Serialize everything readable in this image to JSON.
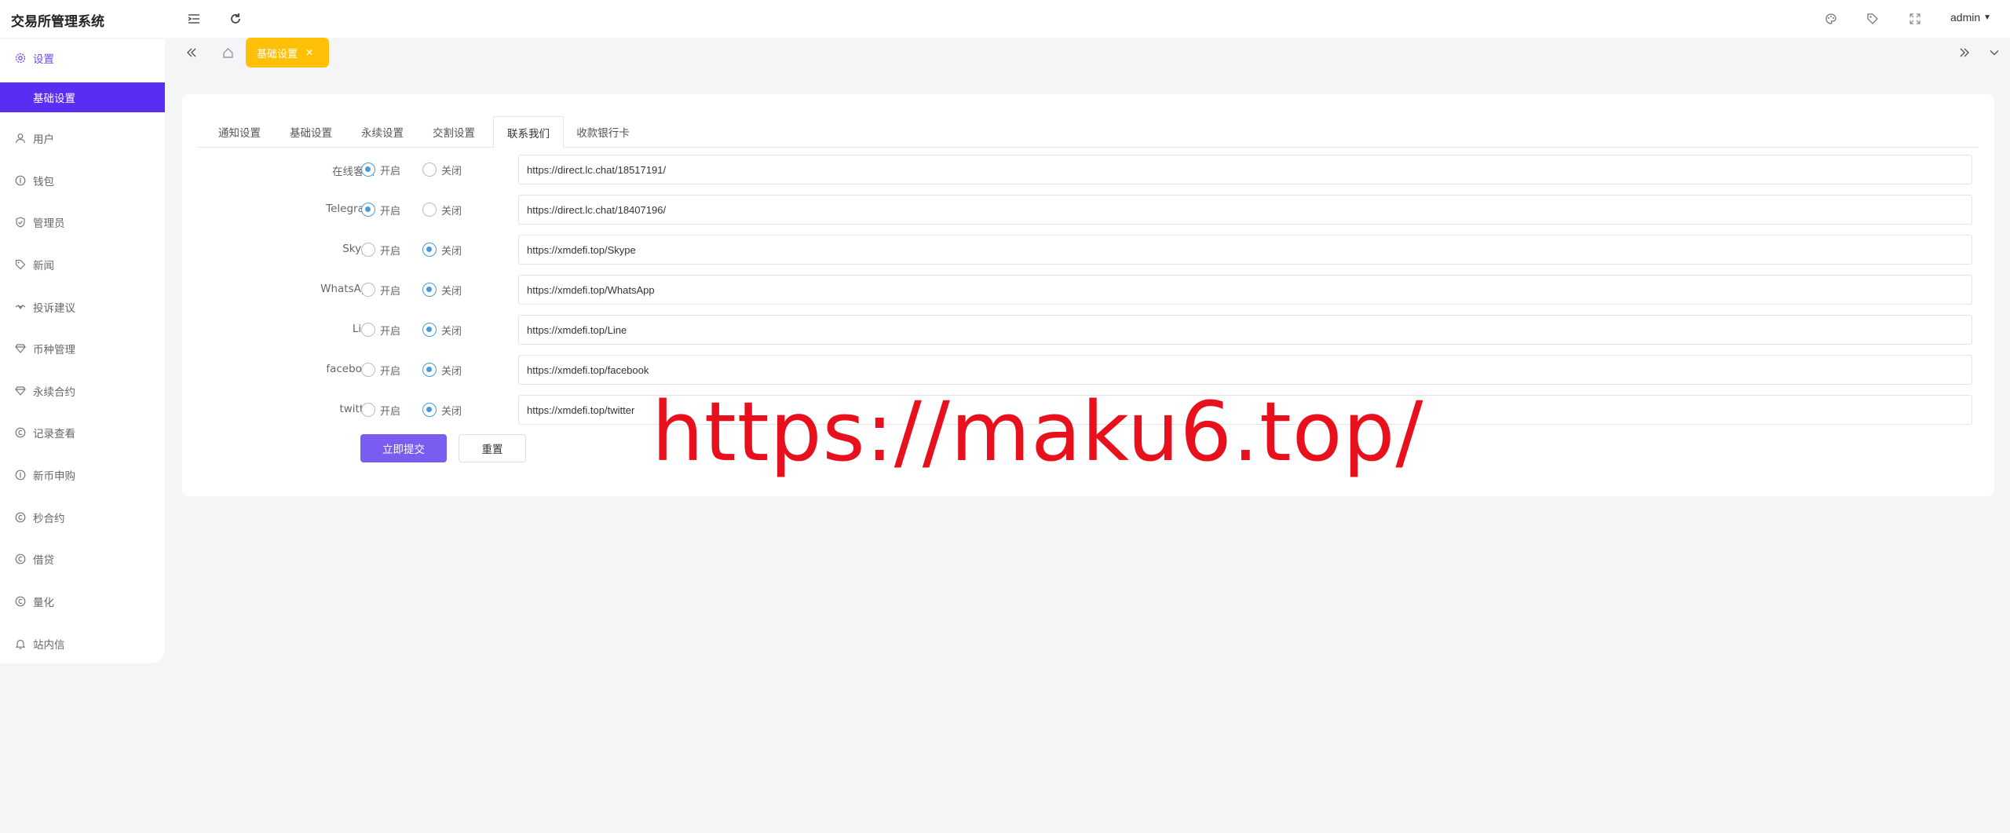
{
  "app": {
    "title": "交易所管理系统"
  },
  "topbar": {
    "user": "admin"
  },
  "sidebar": {
    "items": [
      {
        "label": "设置",
        "icon": "gear-icon"
      },
      {
        "label": "基础设置",
        "icon": ""
      },
      {
        "label": "用户",
        "icon": "user-icon"
      },
      {
        "label": "钱包",
        "icon": "wallet-icon"
      },
      {
        "label": "管理员",
        "icon": "shield-icon"
      },
      {
        "label": "新闻",
        "icon": "tag-icon"
      },
      {
        "label": "投诉建议",
        "icon": "handshake-icon"
      },
      {
        "label": "币种管理",
        "icon": "diamond-icon"
      },
      {
        "label": "永续合约",
        "icon": "diamond-icon"
      },
      {
        "label": "记录查看",
        "icon": "coin-icon"
      },
      {
        "label": "新币申购",
        "icon": "coin-icon"
      },
      {
        "label": "秒合约",
        "icon": "coin-icon"
      },
      {
        "label": "借贷",
        "icon": "coin-icon"
      },
      {
        "label": "量化",
        "icon": "coin-icon"
      },
      {
        "label": "站内信",
        "icon": "bell-icon"
      }
    ]
  },
  "tagbar": {
    "active_tag": "基础设置"
  },
  "tabs": [
    {
      "label": "通知设置"
    },
    {
      "label": "基础设置"
    },
    {
      "label": "永续设置"
    },
    {
      "label": "交割设置"
    },
    {
      "label": "联系我们"
    },
    {
      "label": "收款银行卡"
    }
  ],
  "radio_labels": {
    "on": "开启",
    "off": "关闭"
  },
  "contacts": [
    {
      "label": "在线客服",
      "enabled": true,
      "url": "https://direct.lc.chat/18517191/"
    },
    {
      "label": "Telegram",
      "enabled": true,
      "url": "https://direct.lc.chat/18407196/"
    },
    {
      "label": "Skype",
      "enabled": false,
      "url": "https://xmdefi.top/Skype"
    },
    {
      "label": "WhatsApp",
      "enabled": false,
      "url": "https://xmdefi.top/WhatsApp"
    },
    {
      "label": "Line",
      "enabled": false,
      "url": "https://xmdefi.top/Line"
    },
    {
      "label": "facebook",
      "enabled": false,
      "url": "https://xmdefi.top/facebook"
    },
    {
      "label": "twitter",
      "enabled": false,
      "url": "https://xmdefi.top/twitter"
    }
  ],
  "buttons": {
    "submit": "立即提交",
    "reset": "重置"
  },
  "watermark": {
    "text": "https://maku6.top/"
  },
  "colors": {
    "accent": "#5b2cf2",
    "tag": "#ffc107",
    "radio": "#4a9ad9",
    "submit": "#7b5cf0",
    "watermark": "#e8101c"
  }
}
